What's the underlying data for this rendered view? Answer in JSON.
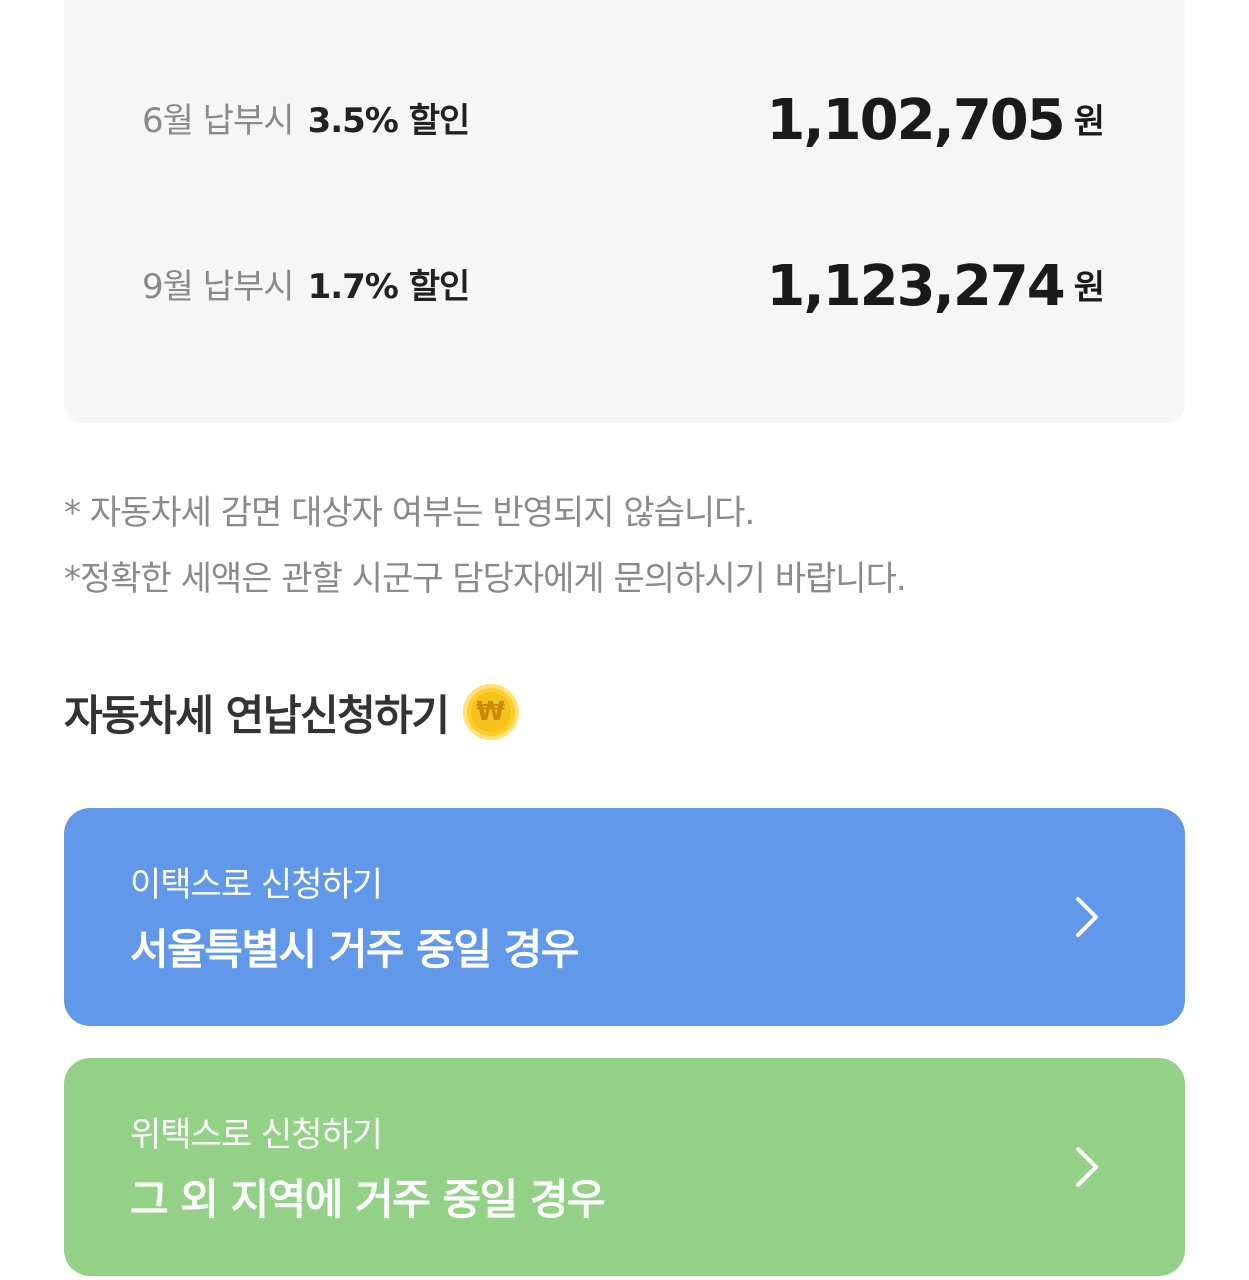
{
  "discounts": [
    {
      "month_label": "6월 납부시",
      "rate_label": "3.5% 할인",
      "amount": "1,102,705",
      "unit": "원"
    },
    {
      "month_label": "9월 납부시",
      "rate_label": "1.7% 할인",
      "amount": "1,123,274",
      "unit": "원"
    }
  ],
  "notes": [
    "* 자동차세 감면 대상자 여부는 반영되지 않습니다.",
    "*정확한 세액은 관할 시군구 담당자에게 문의하시기 바랍니다."
  ],
  "section": {
    "title": "자동차세 연납신청하기",
    "coin_symbol": "₩",
    "icon": "coin-icon"
  },
  "cards": [
    {
      "subtitle": "이택스로 신청하기",
      "title": "서울특별시 거주 중일 경우",
      "color": "#6198ea",
      "icon": "chevron-right-icon"
    },
    {
      "subtitle": "위택스로 신청하기",
      "title": "그 외 지역에 거주 중일 경우",
      "color": "#93d286",
      "icon": "chevron-right-icon"
    }
  ]
}
